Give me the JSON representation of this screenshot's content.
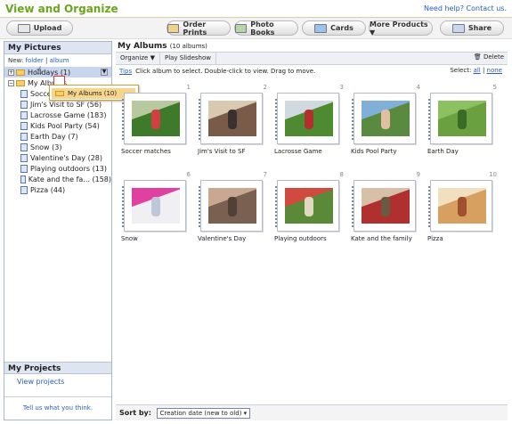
{
  "app": {
    "title": "View and Organize",
    "help": "Need help? Contact us."
  },
  "toolbar": {
    "upload": "Upload",
    "order_prints": "Order Prints",
    "photo_books": "Photo Books",
    "cards": "Cards",
    "more_products": "More Products ▼",
    "share": "Share"
  },
  "sidebar": {
    "title": "My Pictures",
    "new_label": "New:",
    "new_folder": "folder",
    "new_album": "album",
    "holidays": "Holidays (1)",
    "my_albums": "My Albums",
    "albums": [
      {
        "label": "Soccer matches"
      },
      {
        "label": "Jim's Visit to SF (56)"
      },
      {
        "label": "Lacrosse Game (183)"
      },
      {
        "label": "Kids Pool Party (54)"
      },
      {
        "label": "Earth Day (7)"
      },
      {
        "label": "Snow (3)"
      },
      {
        "label": "Valentine's Day (28)"
      },
      {
        "label": "Playing outdoors (13)"
      },
      {
        "label": "Kate and the fa... (158)"
      },
      {
        "label": "Pizza (44)"
      }
    ],
    "projects_title": "My Projects",
    "view_projects": "View projects",
    "feedback": "Tell us what you think."
  },
  "drag": {
    "label": "My Albums (10)"
  },
  "main": {
    "title": "My Albums",
    "count": "(10 albums)",
    "organize": "Organize ▼",
    "slideshow": "Play Slideshow",
    "delete": "Delete",
    "tips": "Tips",
    "tip_text": "Click album to select. Double-click to view. Drag to move.",
    "select_label": "Select:",
    "select_all": "all",
    "select_none": "none",
    "sort_label": "Sort by:",
    "sort_value": "Creation date (new to old) ▾"
  },
  "albums": [
    {
      "num": "1",
      "caption": "Soccer matches",
      "colors": [
        "#3d7a2a",
        "#b8c9a0",
        "#d04040"
      ]
    },
    {
      "num": "2",
      "caption": "Jim's Visit to SF",
      "colors": [
        "#7a5a48",
        "#d9c9b0",
        "#3a3030"
      ]
    },
    {
      "num": "3",
      "caption": "Lacrosse Game",
      "colors": [
        "#4d8a30",
        "#d0d8e0",
        "#b03030"
      ]
    },
    {
      "num": "4",
      "caption": "Kids Pool Party",
      "colors": [
        "#5a8a40",
        "#80b0d8",
        "#e0c0a0"
      ]
    },
    {
      "num": "5",
      "caption": "Earth Day",
      "colors": [
        "#6aa040",
        "#8cc060",
        "#3a6a28"
      ]
    },
    {
      "num": "6",
      "caption": "Snow",
      "colors": [
        "#f0f0f4",
        "#e040a0",
        "#c0c8d8"
      ]
    },
    {
      "num": "7",
      "caption": "Valentine's Day",
      "colors": [
        "#7a6050",
        "#c8a890",
        "#504038"
      ]
    },
    {
      "num": "8",
      "caption": "Playing outdoors",
      "colors": [
        "#5a8a38",
        "#d04a40",
        "#e0d8c0"
      ]
    },
    {
      "num": "9",
      "caption": "Kate and the family",
      "colors": [
        "#b03030",
        "#d8c0a8",
        "#6a5a40"
      ]
    },
    {
      "num": "10",
      "caption": "Pizza",
      "colors": [
        "#d8a060",
        "#f0e0c0",
        "#a05030"
      ]
    }
  ]
}
